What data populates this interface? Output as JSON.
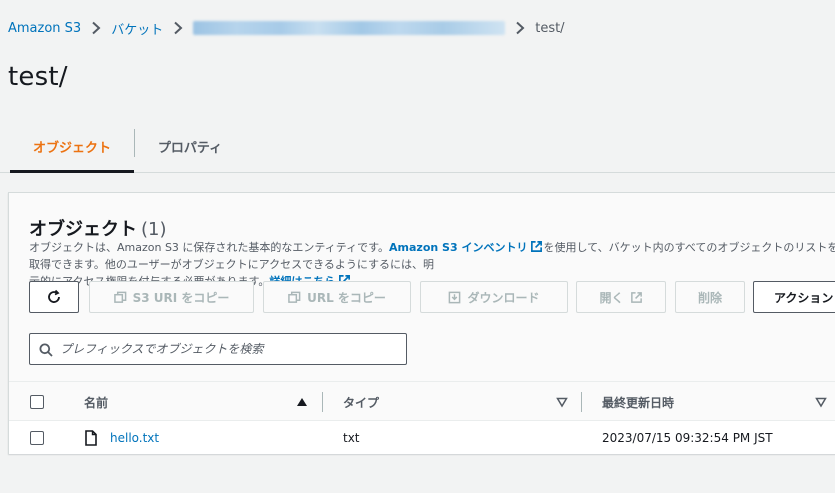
{
  "breadcrumb": {
    "root": "Amazon S3",
    "buckets": "バケット",
    "current": "test/"
  },
  "page_title": "test/",
  "tabs": [
    {
      "label": "オブジェクト",
      "active": true
    },
    {
      "label": "プロパティ",
      "active": false
    }
  ],
  "objects_panel": {
    "title": "オブジェクト",
    "count": "(1)",
    "description": {
      "part1": "オブジェクトは、Amazon S3 に保存された基本的なエンティティです。",
      "link1": "Amazon S3 インベントリ",
      "part2": "を使用して、バケット内のすべてのオブジェクトのリストを取得できます。他のユーザーがオブジェクトにアクセスできるようにするには、明",
      "part3": "示的にアクセス権限を付与する必要があります。",
      "link2": "詳細はこちら"
    },
    "buttons": {
      "refresh": "refresh-icon",
      "copy_s3_uri": "S3 URI をコピー",
      "copy_url": "URL をコピー",
      "download": "ダウンロード",
      "open": "開く",
      "delete": "削除",
      "actions": "アクション"
    },
    "search": {
      "placeholder": "プレフィックスでオブジェクトを検索",
      "value": ""
    },
    "table": {
      "columns": [
        "名前",
        "タイプ",
        "最終更新日時"
      ],
      "rows": [
        {
          "name": "hello.txt",
          "type": "txt",
          "last_modified": "2023/07/15 09:32:54 PM JST"
        }
      ]
    }
  },
  "colors": {
    "accent_orange": "#ec7211",
    "link_blue": "#0073bb",
    "text_dark": "#16191f",
    "text_secondary": "#545b64",
    "border": "#d5dbdb",
    "disabled": "#aab7b8"
  }
}
